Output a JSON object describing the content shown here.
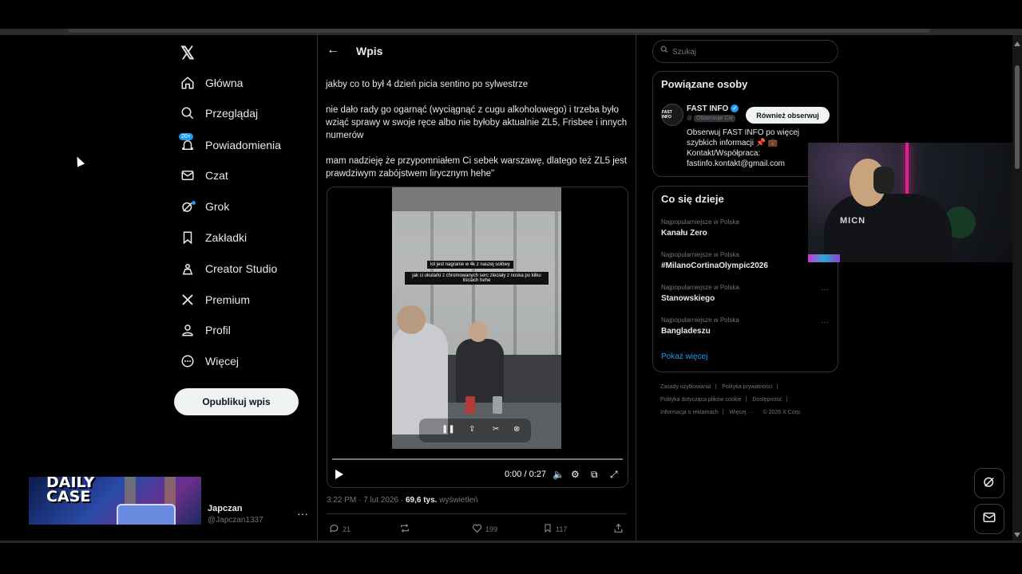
{
  "nav": {
    "logo": "𝕏",
    "items": [
      {
        "icon": "home-icon",
        "glyph": "⌂",
        "label": "Główna"
      },
      {
        "icon": "search-icon",
        "glyph": "⚲",
        "label": "Przeglądaj"
      },
      {
        "icon": "bell-icon",
        "glyph": "♫",
        "label": "Powiadomienia",
        "badge": "20+"
      },
      {
        "icon": "mail-icon",
        "glyph": "✉",
        "label": "Czat"
      },
      {
        "icon": "grok-icon",
        "glyph": "⊘",
        "label": "Grok"
      },
      {
        "icon": "bookmark-icon",
        "glyph": "▯",
        "label": "Zakładki"
      },
      {
        "icon": "creator-studio-icon",
        "glyph": "♙",
        "label": "Creator Studio"
      },
      {
        "icon": "x-premium-icon",
        "glyph": "✕",
        "label": "Premium"
      },
      {
        "icon": "profile-icon",
        "glyph": "♙",
        "label": "Profil"
      },
      {
        "icon": "more-circle-icon",
        "glyph": "⋯",
        "label": "Więcej"
      }
    ],
    "post_button": "Opublikuj wpis",
    "account": {
      "name": "Japczan",
      "handle": "@Japczan1337",
      "more": "···"
    }
  },
  "overlay": {
    "ad_title_1": "DAILY",
    "ad_title_2": "CASE",
    "webcam_label": "MICN"
  },
  "main": {
    "back": "←",
    "title": "Wpis",
    "paragraphs": [
      "jakby co to był 4 dzień picia sentino po sylwestrze",
      "nie dało rady go ogarnąć (wyciągnąć z cugu alkoholowego) i trzeba było wziąć sprawy w swoje ręce albo nie byłoby aktualnie ZL5, Frisbee i innych numerów",
      "mam nadzieję że przypomniałem Ci sebek warszawę, dlatego też ZL5 jest prawdziwym zabójstwem lirycznym hehe\""
    ],
    "video": {
      "caption_1": "lol jest nagranie w 4k z naszej solówy",
      "caption_2": "jak ci okularki z chromowanych serc zleciały z noska po kilku liściach hehe",
      "time": "0:00 / 0:27",
      "progress": 0.0
    },
    "meta": {
      "time": "3:22 PM · 7 lut 2026 · ",
      "views": "69,6 tys.",
      "views_label": " wyświetleń"
    },
    "actions": {
      "replies": "21",
      "reposts": "",
      "likes": "199",
      "bookmarks": "117"
    }
  },
  "right": {
    "search_placeholder": "Szukaj",
    "related": {
      "heading": "Powiązane osoby",
      "avatar_text": "FAST INFO",
      "name": "FAST INFO",
      "handle": "@",
      "follows_you": "Obserwuje Cię",
      "follow_btn": "Również obserwuj",
      "bio": "Obserwuj FAST INFO po więcej szybkich informacji 📌 💼 Kontakt/Współpraca: fastinfo.kontakt@gmail.com"
    },
    "trends": {
      "heading": "Co się dzieje",
      "items": [
        {
          "context": "Najpopularniejsze w Polska",
          "name": "Kanału Zero"
        },
        {
          "context": "Najpopularniejsze w Polska",
          "name": "#MilanoCortinaOlympic2026"
        },
        {
          "context": "Najpopularniejsze w Polska",
          "name": "Stanowskiego"
        },
        {
          "context": "Najpopularniejsze w Polska",
          "name": "Bangladeszu"
        }
      ],
      "show_more": "Pokaż więcej"
    },
    "footer": {
      "terms": "Zasady użytkowania",
      "privacy": "Polityka prywatności",
      "cookies": "Polityka dotycząca plików cookie",
      "accessibility": "Dostępność",
      "ads": "Informacja o reklamach",
      "more": "Więcej ···",
      "copyright": "© 2026 X Corp."
    }
  },
  "colors": {
    "accent": "#1d9bf0",
    "background": "#000000",
    "border": "#2f3336",
    "muted": "#71767b"
  }
}
